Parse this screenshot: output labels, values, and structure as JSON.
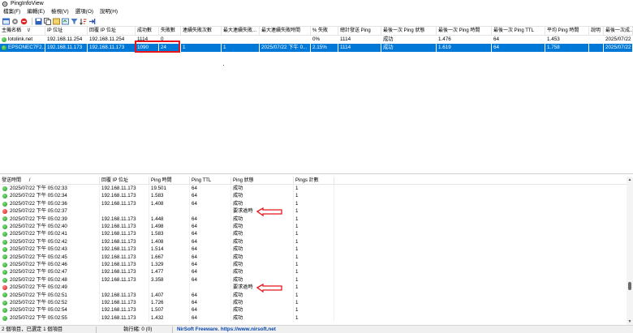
{
  "window": {
    "title": "PingInfoView"
  },
  "menu": [
    "檔案(F)",
    "編輯(E)",
    "檢視(V)",
    "選項(O)",
    "說明(H)"
  ],
  "toolbar_icons": [
    "new-icon",
    "options-icon",
    "stop-icon",
    "save-icon",
    "copy-icon",
    "properties-icon",
    "refresh-icon",
    "filter-icon",
    "sort-icon",
    "exit-icon"
  ],
  "top_table": {
    "columns": [
      "主機名稱",
      "IP 位址",
      "回覆 IP 位址",
      "成功數",
      "失敗數",
      "連續失敗次數",
      "最大連續失敗...",
      "最大連續失敗時間",
      "% 失敗",
      "總計發送 Ping",
      "最後一次 Ping 狀態",
      "最後一次 Ping 時間",
      "最後一次 Ping TTL",
      "平均 Ping 時間",
      "說明",
      "最後一次成..."
    ],
    "sort_indicator": "\\/",
    "rows": [
      {
        "status": "green",
        "cells": [
          "lotolink.net",
          "192.168.11.254",
          "192.168.11.254",
          "1114",
          "0",
          "",
          "",
          "",
          "0%",
          "1114",
          "成功",
          "1.476",
          "64",
          "1.453",
          "",
          "2025/07/22"
        ],
        "selected": false
      },
      {
        "status": "green",
        "cells": [
          "EPSONEC7F2...",
          "192.168.11.173",
          "192.168.11.173",
          "1090",
          "24",
          "1",
          "1",
          "2025/07/22 下午 0...",
          "2.15%",
          "1114",
          "成功",
          "1.619",
          "64",
          "1.758",
          "",
          "2025/07/22"
        ],
        "selected": true
      }
    ]
  },
  "bottom_table": {
    "columns": [
      "發送時間",
      "回覆 IP 位址",
      "Ping 時間",
      "Ping TTL",
      "Ping 狀態",
      "Pings 計數"
    ],
    "sort_indicator": "/",
    "rows": [
      {
        "status": "green",
        "time": "2025/07/22 下午 05:02:33",
        "ip": "192.168.11.173",
        "ping": "19.501",
        "ttl": "64",
        "state": "成功",
        "count": "1"
      },
      {
        "status": "green",
        "time": "2025/07/22 下午 05:02:34",
        "ip": "192.168.11.173",
        "ping": "1.583",
        "ttl": "64",
        "state": "成功",
        "count": "1"
      },
      {
        "status": "green",
        "time": "2025/07/22 下午 05:02:36",
        "ip": "192.168.11.173",
        "ping": "1.408",
        "ttl": "64",
        "state": "成功",
        "count": "1"
      },
      {
        "status": "red",
        "time": "2025/07/22 下午 05:02:37",
        "ip": "",
        "ping": "",
        "ttl": "",
        "state": "要求逾時",
        "count": "1"
      },
      {
        "status": "green",
        "time": "2025/07/22 下午 05:02:39",
        "ip": "192.168.11.173",
        "ping": "1.448",
        "ttl": "64",
        "state": "成功",
        "count": "1"
      },
      {
        "status": "green",
        "time": "2025/07/22 下午 05:02:40",
        "ip": "192.168.11.173",
        "ping": "1.498",
        "ttl": "64",
        "state": "成功",
        "count": "1"
      },
      {
        "status": "green",
        "time": "2025/07/22 下午 05:02:41",
        "ip": "192.168.11.173",
        "ping": "1.583",
        "ttl": "64",
        "state": "成功",
        "count": "1"
      },
      {
        "status": "green",
        "time": "2025/07/22 下午 05:02:42",
        "ip": "192.168.11.173",
        "ping": "1.408",
        "ttl": "64",
        "state": "成功",
        "count": "1"
      },
      {
        "status": "green",
        "time": "2025/07/22 下午 05:02:43",
        "ip": "192.168.11.173",
        "ping": "1.514",
        "ttl": "64",
        "state": "成功",
        "count": "1"
      },
      {
        "status": "green",
        "time": "2025/07/22 下午 05:02:45",
        "ip": "192.168.11.173",
        "ping": "1.667",
        "ttl": "64",
        "state": "成功",
        "count": "1"
      },
      {
        "status": "green",
        "time": "2025/07/22 下午 05:02:46",
        "ip": "192.168.11.173",
        "ping": "1.329",
        "ttl": "64",
        "state": "成功",
        "count": "1"
      },
      {
        "status": "green",
        "time": "2025/07/22 下午 05:02:47",
        "ip": "192.168.11.173",
        "ping": "1.477",
        "ttl": "64",
        "state": "成功",
        "count": "1"
      },
      {
        "status": "green",
        "time": "2025/07/22 下午 05:02:48",
        "ip": "192.168.11.173",
        "ping": "3.358",
        "ttl": "64",
        "state": "成功",
        "count": "1"
      },
      {
        "status": "red",
        "time": "2025/07/22 下午 05:02:49",
        "ip": "",
        "ping": "",
        "ttl": "",
        "state": "要求逾時",
        "count": "1"
      },
      {
        "status": "green",
        "time": "2025/07/22 下午 05:02:51",
        "ip": "192.168.11.173",
        "ping": "1.407",
        "ttl": "64",
        "state": "成功",
        "count": "1"
      },
      {
        "status": "green",
        "time": "2025/07/22 下午 05:02:52",
        "ip": "192.168.11.173",
        "ping": "1.726",
        "ttl": "64",
        "state": "成功",
        "count": "1"
      },
      {
        "status": "green",
        "time": "2025/07/22 下午 05:02:54",
        "ip": "192.168.11.173",
        "ping": "1.507",
        "ttl": "64",
        "state": "成功",
        "count": "1"
      },
      {
        "status": "green",
        "time": "2025/07/22 下午 05:02:55",
        "ip": "192.168.11.173",
        "ping": "1.432",
        "ttl": "64",
        "state": "成功",
        "count": "1"
      }
    ]
  },
  "statusbar": {
    "items_text": "2 個項目，已選定 1 個項目",
    "threads_text": "執行緒: 0 (0)",
    "credit_text": "NirSoft Freeware. https://www.nirsoft.net"
  },
  "colors": {
    "selection": "#0078d7",
    "highlight_box": "#e8141a",
    "annotation_arrow": "#e8141a",
    "ok": "#1a9a1a",
    "fail": "#d11111",
    "link": "#0645ad"
  }
}
